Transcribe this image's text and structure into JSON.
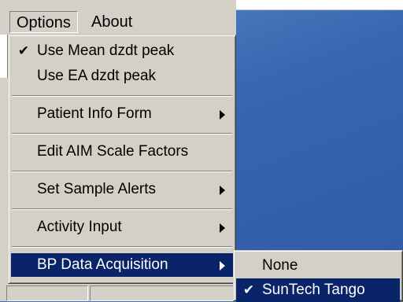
{
  "menubar": {
    "items": [
      {
        "label": "Options"
      },
      {
        "label": "About"
      }
    ]
  },
  "options_menu": {
    "items": [
      {
        "label": "Use Mean dzdt peak",
        "checked": true,
        "submenu": false
      },
      {
        "label": "Use EA dzdt peak",
        "checked": false,
        "submenu": false
      },
      {
        "label": "Patient Info Form",
        "checked": false,
        "submenu": true
      },
      {
        "label": "Edit AIM Scale Factors",
        "checked": false,
        "submenu": false
      },
      {
        "label": "Set Sample Alerts",
        "checked": false,
        "submenu": true
      },
      {
        "label": "Activity Input",
        "checked": false,
        "submenu": true
      },
      {
        "label": "BP Data Acquisition",
        "checked": false,
        "submenu": true,
        "selected": true
      }
    ]
  },
  "bp_submenu": {
    "items": [
      {
        "label": "None",
        "checked": false
      },
      {
        "label": "SunTech Tango",
        "checked": true,
        "selected": true
      }
    ]
  },
  "icons": {
    "check": "✔"
  },
  "colors": {
    "menu_bg": "#d4d0c8",
    "highlight": "#0a246a",
    "desktop": "#3a66b0"
  }
}
